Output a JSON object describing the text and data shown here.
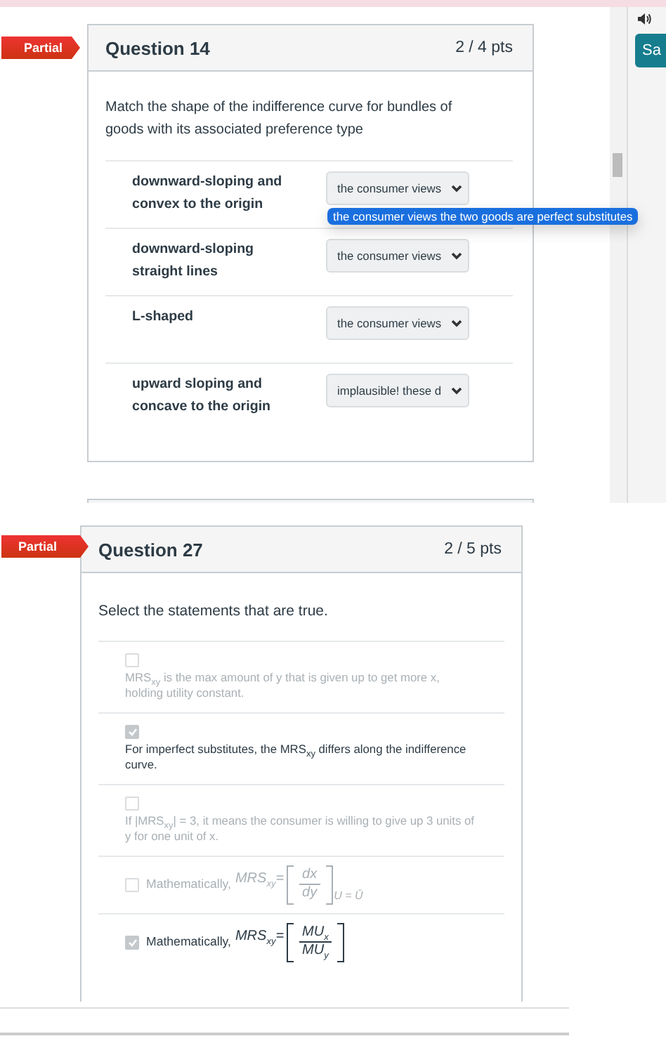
{
  "sidebar": {
    "save_button": "Sa"
  },
  "question14": {
    "badge": "Partial",
    "title": "Question 14",
    "points": "2 / 4 pts",
    "prompt": "Match the shape of the indifference curve for bundles of goods with its associated preference type",
    "matches": [
      {
        "label": "downward-sloping and convex to the origin",
        "answer": "the consumer views",
        "option": "the consumer views the two goods are perfect substitutes"
      },
      {
        "label": "downward-sloping straight lines",
        "answer": "the consumer views"
      },
      {
        "label": "L-shaped",
        "answer": "the consumer views"
      },
      {
        "label": "upward sloping and concave to the origin",
        "answer": "implausible! these d"
      }
    ]
  },
  "question27": {
    "badge": "Partial",
    "title": "Question 27",
    "points": "2 / 5 pts",
    "prompt": "Select the statements that are true.",
    "options": [
      {
        "kind": "text",
        "checked": false,
        "text": "MRS$_{xy}$ is the max amount of y that is given up to get more x, holding utility constant."
      },
      {
        "kind": "text",
        "checked": true,
        "text": "For imperfect substitutes, the MRS$_{xy}$ differs along the indifference curve."
      },
      {
        "kind": "text",
        "checked": false,
        "text": "If |MRS$_{xy}$| = 3, it means the consumer is willing to give up 3 units of y for one unit of x."
      },
      {
        "kind": "formula",
        "checked": false,
        "label": "Mathematically,",
        "lhs": "MRS$_{xy}$=",
        "numerator": "dx",
        "denominator": "dy",
        "condition": "U = Ū"
      },
      {
        "kind": "formula",
        "checked": true,
        "label": "Mathematically,",
        "lhs": "MRS$_{xy}$=",
        "numerator": "MU$_{x}$",
        "denominator": "MU$_{y}$"
      }
    ]
  }
}
